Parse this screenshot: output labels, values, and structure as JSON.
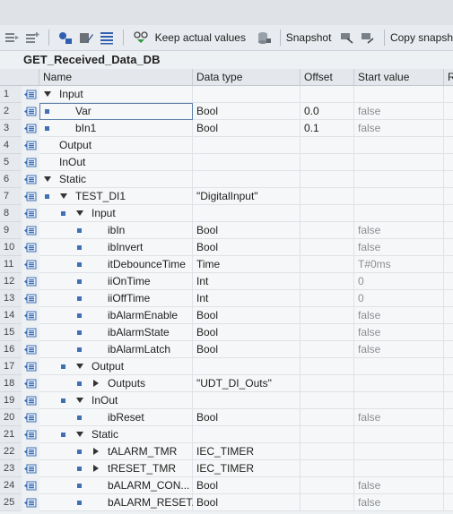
{
  "toolbar": {
    "keep_actual_label": "Keep actual values",
    "snapshot_label": "Snapshot",
    "copy_snapshot_label": "Copy snapsh"
  },
  "db_title": "GET_Received_Data_DB",
  "columns": {
    "name": "Name",
    "data_type": "Data type",
    "offset": "Offset",
    "start_value": "Start value",
    "r": "Re"
  },
  "rows": [
    {
      "n": "1",
      "name": "Input",
      "type": "",
      "offset": "",
      "start": ""
    },
    {
      "n": "2",
      "name": "Var",
      "type": "Bool",
      "offset": "0.0",
      "start": "false"
    },
    {
      "n": "3",
      "name": "bIn1",
      "type": "Bool",
      "offset": "0.1",
      "start": "false"
    },
    {
      "n": "4",
      "name": "Output",
      "type": "",
      "offset": "",
      "start": ""
    },
    {
      "n": "5",
      "name": "InOut",
      "type": "",
      "offset": "",
      "start": ""
    },
    {
      "n": "6",
      "name": "Static",
      "type": "",
      "offset": "",
      "start": ""
    },
    {
      "n": "7",
      "name": "TEST_DI1",
      "type": "\"DigitalInput\"",
      "offset": "",
      "start": ""
    },
    {
      "n": "8",
      "name": "Input",
      "type": "",
      "offset": "",
      "start": ""
    },
    {
      "n": "9",
      "name": "ibIn",
      "type": "Bool",
      "offset": "",
      "start": "false"
    },
    {
      "n": "10",
      "name": "ibInvert",
      "type": "Bool",
      "offset": "",
      "start": "false"
    },
    {
      "n": "11",
      "name": "itDebounceTime",
      "type": "Time",
      "offset": "",
      "start": "T#0ms"
    },
    {
      "n": "12",
      "name": "iiOnTime",
      "type": "Int",
      "offset": "",
      "start": "0"
    },
    {
      "n": "13",
      "name": "iiOffTime",
      "type": "Int",
      "offset": "",
      "start": "0"
    },
    {
      "n": "14",
      "name": "ibAlarmEnable",
      "type": "Bool",
      "offset": "",
      "start": "false"
    },
    {
      "n": "15",
      "name": "ibAlarmState",
      "type": "Bool",
      "offset": "",
      "start": "false"
    },
    {
      "n": "16",
      "name": "ibAlarmLatch",
      "type": "Bool",
      "offset": "",
      "start": "false"
    },
    {
      "n": "17",
      "name": "Output",
      "type": "",
      "offset": "",
      "start": ""
    },
    {
      "n": "18",
      "name": "Outputs",
      "type": "\"UDT_DI_Outs\"",
      "offset": "",
      "start": ""
    },
    {
      "n": "19",
      "name": "InOut",
      "type": "",
      "offset": "",
      "start": ""
    },
    {
      "n": "20",
      "name": "ibReset",
      "type": "Bool",
      "offset": "",
      "start": "false"
    },
    {
      "n": "21",
      "name": "Static",
      "type": "",
      "offset": "",
      "start": ""
    },
    {
      "n": "22",
      "name": "tALARM_TMR",
      "type": "IEC_TIMER",
      "offset": "",
      "start": ""
    },
    {
      "n": "23",
      "name": "tRESET_TMR",
      "type": "IEC_TIMER",
      "offset": "",
      "start": ""
    },
    {
      "n": "24",
      "name": "bALARM_CON...",
      "type": "Bool",
      "offset": "",
      "start": "false"
    },
    {
      "n": "25",
      "name": "bALARM_RESET...",
      "type": "Bool",
      "offset": "",
      "start": "false"
    }
  ],
  "colors": {
    "icon_blue": "#3f6fb5",
    "start_grey": "#8a8e93"
  }
}
